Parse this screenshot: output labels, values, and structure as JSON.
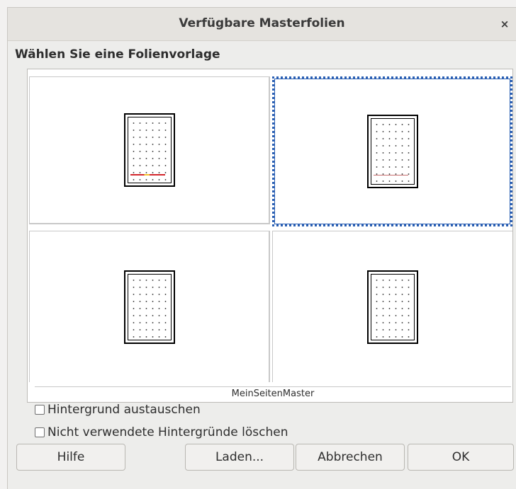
{
  "dialog": {
    "title": "Verfügbare Masterfolien",
    "close_label": "×"
  },
  "heading": "Wählen Sie eine Folienvorlage",
  "masters": [
    {
      "selected": false,
      "accent": "red"
    },
    {
      "selected": true,
      "accent": "thin"
    },
    {
      "selected": false,
      "accent": "none"
    },
    {
      "selected": false,
      "accent": "none"
    }
  ],
  "selected_master_name": "MeinSeitenMaster",
  "options": {
    "exchange_background_label": "Hintergrund austauschen",
    "exchange_background_checked": false,
    "delete_unused_label": "Nicht verwendete Hintergründe löschen",
    "delete_unused_checked": false
  },
  "buttons": {
    "help": "Hilfe",
    "load": "Laden...",
    "cancel": "Abbrechen",
    "ok": "OK"
  },
  "colors": {
    "selection": "#2a5fb3",
    "accent_red": "#d2252b",
    "accent_yellow": "#f3c22b"
  }
}
